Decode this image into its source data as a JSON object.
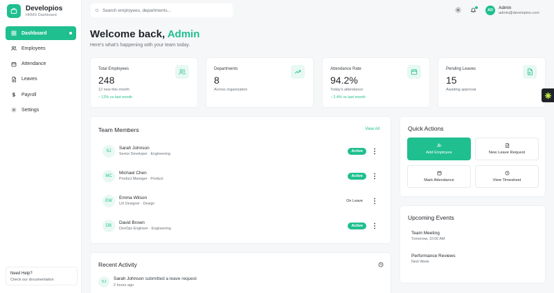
{
  "brand": {
    "name": "Developios",
    "subtitle": "HRMS Dashboard"
  },
  "nav": [
    {
      "label": "Dashboard",
      "icon": "dashboard-icon",
      "active": true
    },
    {
      "label": "Employees",
      "icon": "users-icon"
    },
    {
      "label": "Attendance",
      "icon": "calendar-icon"
    },
    {
      "label": "Leaves",
      "icon": "file-icon"
    },
    {
      "label": "Payroll",
      "icon": "dollar-icon"
    },
    {
      "label": "Settings",
      "icon": "gear-icon"
    }
  ],
  "help": {
    "title": "Need Help?",
    "link": "Check our documentation"
  },
  "search": {
    "placeholder": "Search employees, departments..."
  },
  "user": {
    "initials": "AD",
    "name": "Admin",
    "email": "admin@developios.com"
  },
  "welcome": {
    "prefix": "Welcome back, ",
    "name": "Admin",
    "subtitle": "Here's what's happening with your team today."
  },
  "stats": [
    {
      "label": "Total Employees",
      "value": "248",
      "note": "12 new this month",
      "trend": "↑ 12% vs last month",
      "icon": "users-icon"
    },
    {
      "label": "Departments",
      "value": "8",
      "note": "Across organization",
      "trend": "",
      "icon": "trend-up-icon"
    },
    {
      "label": "Attendance Rate",
      "value": "94.2%",
      "note": "Today's attendance",
      "trend": "↑ 2.4% vs last month",
      "icon": "calendar-icon"
    },
    {
      "label": "Pending Leaves",
      "value": "15",
      "note": "Awaiting approval",
      "trend": "",
      "icon": "file-icon"
    }
  ],
  "team": {
    "title": "Team Members",
    "view_all": "View All",
    "members": [
      {
        "initials": "SJ",
        "name": "Sarah Johnson",
        "role": "Senior Developer · Engineering",
        "status": "Active"
      },
      {
        "initials": "MC",
        "name": "Michael Chen",
        "role": "Product Manager · Product",
        "status": "Active"
      },
      {
        "initials": "EW",
        "name": "Emma Wilson",
        "role": "UX Designer · Design",
        "status": "On Leave"
      },
      {
        "initials": "DB",
        "name": "David Brown",
        "role": "DevOps Engineer · Engineering",
        "status": "Active"
      }
    ]
  },
  "quick_actions": {
    "title": "Quick Actions",
    "items": [
      {
        "label": "Add Employee",
        "icon": "user-plus-icon",
        "primary": true
      },
      {
        "label": "New Leave Request",
        "icon": "file-icon"
      },
      {
        "label": "Mark Attendance",
        "icon": "calendar-icon"
      },
      {
        "label": "View Timesheet",
        "icon": "clock-icon"
      }
    ]
  },
  "events": {
    "title": "Upcoming Events",
    "items": [
      {
        "title": "Team Meeting",
        "time": "Tomorrow, 10:00 AM"
      },
      {
        "title": "Performance Reviews",
        "time": "Next Week"
      }
    ]
  },
  "activity": {
    "title": "Recent Activity",
    "items": [
      {
        "initials": "SJ",
        "actor": "Sarah Johnson",
        "text": " submitted a leave request",
        "time": "2 hours ago"
      }
    ]
  },
  "colors": {
    "accent": "#1fbf8f",
    "accent_light": "#e8f8f2",
    "background": "#f6f7f8"
  }
}
